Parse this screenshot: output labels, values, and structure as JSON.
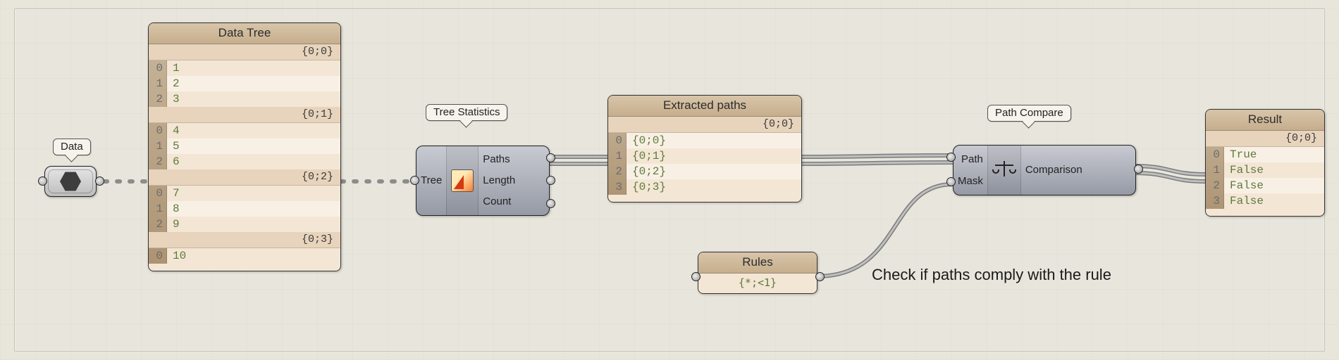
{
  "labels": {
    "data": "Data",
    "tree_stats": "Tree Statistics",
    "path_compare": "Path Compare"
  },
  "annotation": "Check if paths comply with the rule",
  "data_tree": {
    "title": "Data Tree",
    "branches": [
      {
        "path": "{0;0}",
        "items": [
          "1",
          "2",
          "3"
        ]
      },
      {
        "path": "{0;1}",
        "items": [
          "4",
          "5",
          "6"
        ]
      },
      {
        "path": "{0;2}",
        "items": [
          "7",
          "8",
          "9"
        ]
      },
      {
        "path": "{0;3}",
        "items": [
          "10"
        ]
      }
    ]
  },
  "tree_stats": {
    "in": "Tree",
    "out1": "Paths",
    "out2": "Length",
    "out3": "Count"
  },
  "extracted_paths": {
    "title": "Extracted paths",
    "path": "{0;0}",
    "items": [
      "{0;0}",
      "{0;1}",
      "{0;2}",
      "{0;3}"
    ]
  },
  "rules": {
    "title": "Rules",
    "value": "{*;<1}"
  },
  "path_compare": {
    "in1": "Path",
    "in2": "Mask",
    "out": "Comparison"
  },
  "result": {
    "title": "Result",
    "path": "{0;0}",
    "items": [
      "True",
      "False",
      "False",
      "False"
    ]
  }
}
